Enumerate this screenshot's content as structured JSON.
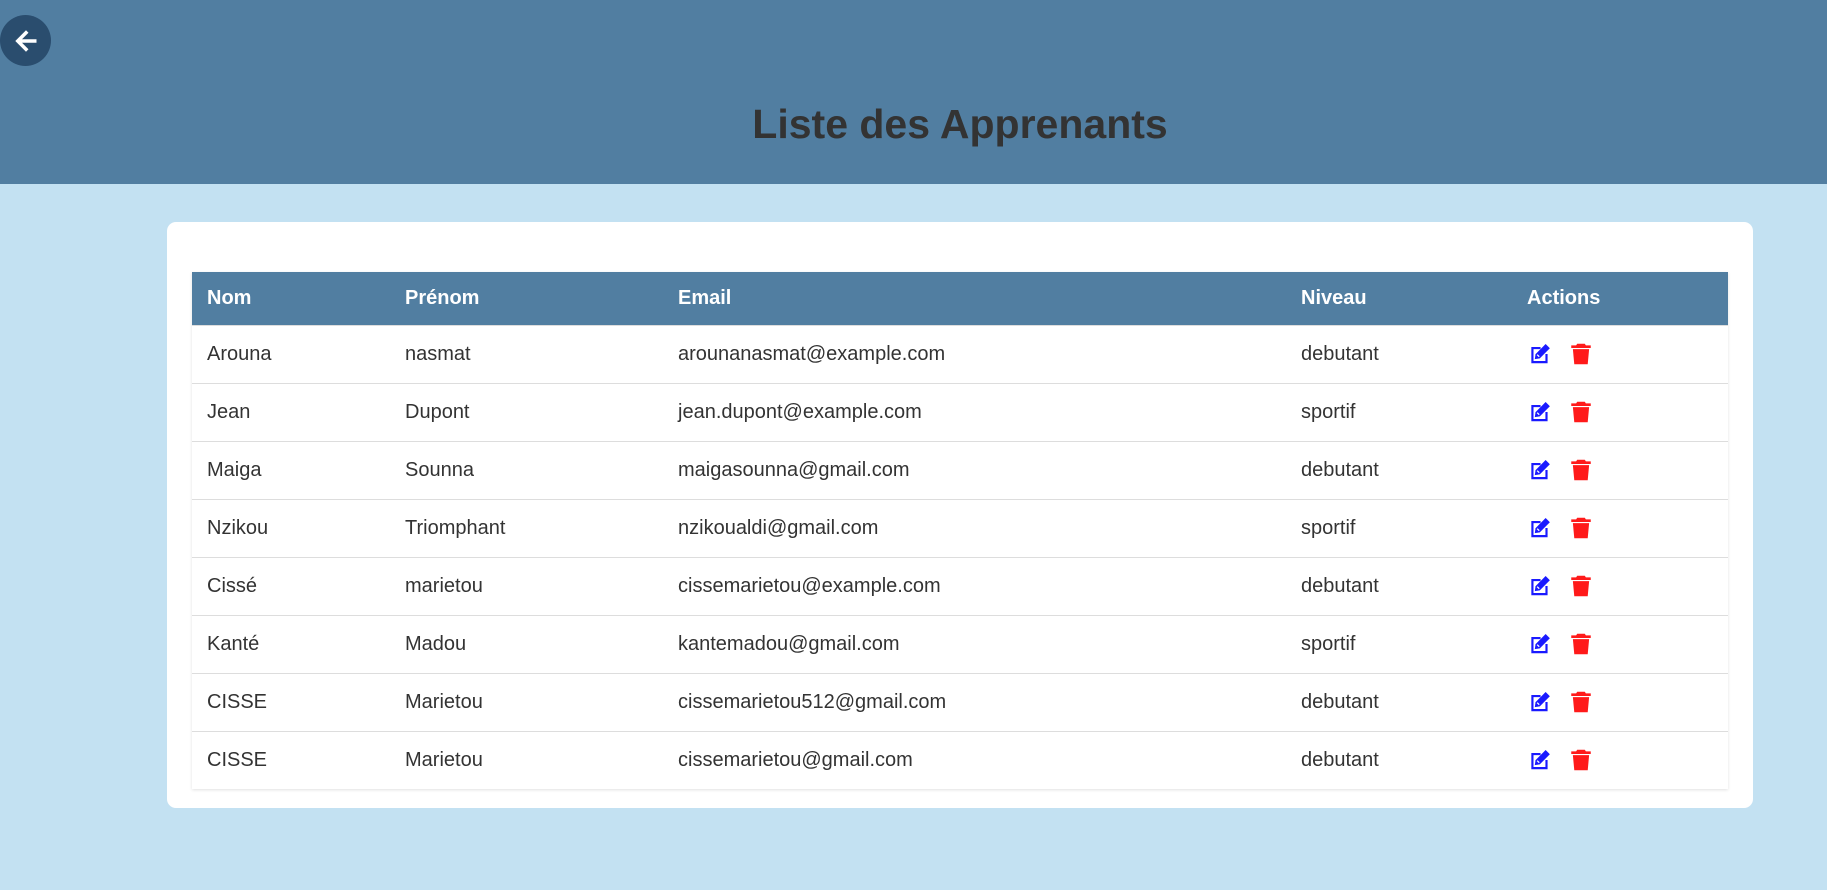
{
  "header": {
    "title": "Liste des Apprenants",
    "back_icon": "arrow-left-icon"
  },
  "table": {
    "columns": [
      "Nom",
      "Prénom",
      "Email",
      "Niveau",
      "Actions"
    ],
    "rows": [
      {
        "nom": "Arouna",
        "prenom": "nasmat",
        "email": "arounanasmat@example.com",
        "niveau": "debutant"
      },
      {
        "nom": "Jean",
        "prenom": "Dupont",
        "email": "jean.dupont@example.com",
        "niveau": "sportif"
      },
      {
        "nom": "Maiga",
        "prenom": "Sounna",
        "email": "maigasounna@gmail.com",
        "niveau": "debutant"
      },
      {
        "nom": "Nzikou",
        "prenom": "Triomphant",
        "email": "nzikoualdi@gmail.com",
        "niveau": "sportif"
      },
      {
        "nom": "Cissé",
        "prenom": "marietou",
        "email": "cissemarietou@example.com",
        "niveau": "debutant"
      },
      {
        "nom": "Kanté",
        "prenom": "Madou",
        "email": "kantemadou@gmail.com",
        "niveau": "sportif"
      },
      {
        "nom": "CISSE",
        "prenom": "Marietou",
        "email": "cissemarietou512@gmail.com",
        "niveau": "debutant"
      },
      {
        "nom": "CISSE",
        "prenom": "Marietou",
        "email": "cissemarietou@gmail.com",
        "niveau": "debutant"
      }
    ],
    "action_icons": {
      "edit": "edit-icon",
      "delete": "trash-icon"
    }
  },
  "colors": {
    "header_bg": "#517ea1",
    "page_bg": "#c3e1f2",
    "edit_icon": "#1a1aff",
    "delete_icon": "#ff1a1a",
    "back_button_bg": "#2a4d6e"
  }
}
